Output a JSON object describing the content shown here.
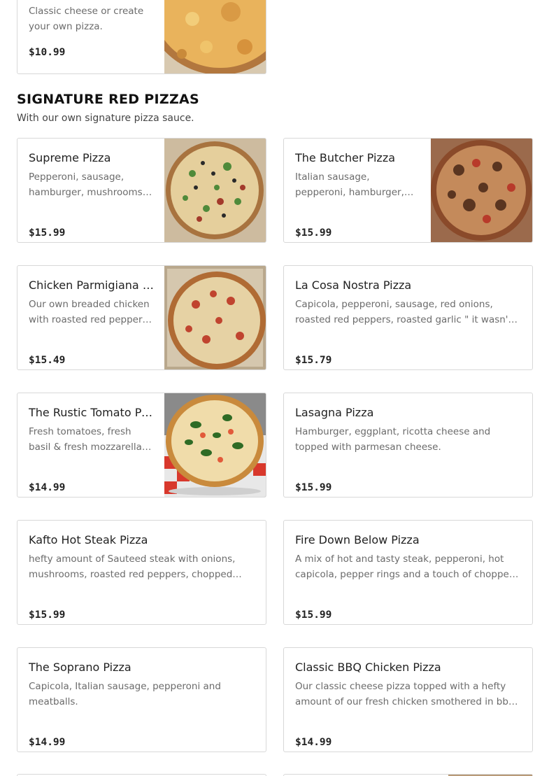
{
  "top_card": {
    "description": "Classic cheese or create your own pizza.",
    "price": "$10.99",
    "image": "cheese-pizza-photo"
  },
  "section": {
    "title": "SIGNATURE RED PIZZAS",
    "subtitle": "With our own signature pizza sauce."
  },
  "items": [
    {
      "name": "Supreme Pizza",
      "description": "Pepperoni, sausage, hamburger, mushrooms, onions, peppers and olives.",
      "price": "$15.99",
      "image": "supreme-pizza-photo"
    },
    {
      "name": "The Butcher Pizza",
      "description": "Italian sausage, pepperoni, hamburger, crispy bacon, ham and meatballs.",
      "price": "$15.99",
      "image": "butcher-pizza-photo"
    },
    {
      "name": "Chicken Parmigiana Pizza",
      "description": "Our own breaded chicken with roasted red peppers and fresh mozzarella.",
      "price": "$15.49",
      "image": "chicken-parmigiana-pizza-photo"
    },
    {
      "name": "La Cosa Nostra Pizza",
      "description": "Capicola, pepperoni, sausage, red onions, roasted red peppers, roasted garlic \" it wasn't me \".",
      "price": "$15.79"
    },
    {
      "name": "The Rustic Tomato Pizza",
      "description": "Fresh tomatoes, fresh basil & fresh mozzarella cheese.",
      "price": "$14.99",
      "image": "rustic-tomato-pizza-photo"
    },
    {
      "name": "Lasagna Pizza",
      "description": "Hamburger, eggplant, ricotta cheese and topped with parmesan cheese.",
      "price": "$15.99"
    },
    {
      "name": "Kafto Hot Steak Pizza",
      "description": "hefty amount of Sauteed steak with onions, mushrooms, roasted red peppers, chopped garlic and hot cherry peppers.",
      "price": "$15.99"
    },
    {
      "name": "Fire Down Below Pizza",
      "description": "A mix of hot and tasty steak, pepperoni, hot capicola, pepper rings and a touch of chopped jalapenos.",
      "price": "$15.99"
    },
    {
      "name": "The Soprano Pizza",
      "description": "Capicola, Italian sausage, pepperoni and meatballs.",
      "price": "$14.99"
    },
    {
      "name": "Classic BBQ Chicken Pizza",
      "description": "Our classic cheese pizza topped with a hefty amount of our fresh chicken smothered in bbq sauce.",
      "price": "$14.99"
    }
  ]
}
